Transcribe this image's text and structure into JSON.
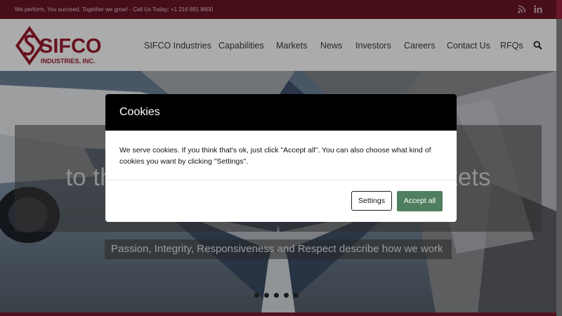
{
  "topbar": {
    "tagline": "We perform, You succeed, Together we grow! - Call Us Today: +1 216 881 8600",
    "icons": [
      "rss-icon",
      "linkedin-icon"
    ]
  },
  "header": {
    "logo_text": "SIFCO",
    "logo_subtext": "INDUSTRIES, INC.",
    "nav": [
      "SIFCO Industries",
      "Capabilities",
      "Markets",
      "News",
      "Investors",
      "Careers",
      "Contact Us",
      "RFQs"
    ],
    "search_icon": "search-icon"
  },
  "hero": {
    "caption": "to the Aerospace and Defense Markets",
    "subcaption": "Passion, Integrity, Responsiveness and Respect describe how we work",
    "dots_count": 5
  },
  "cookie_modal": {
    "title": "Cookies",
    "body": "We serve cookies. If you think that's ok, just click \"Accept all\". You can also choose what kind of cookies you want by clicking \"Settings\".",
    "settings_label": "Settings",
    "accept_label": "Accept all"
  },
  "colors": {
    "brand": "#6a1628",
    "accept": "#4f7f5e"
  }
}
